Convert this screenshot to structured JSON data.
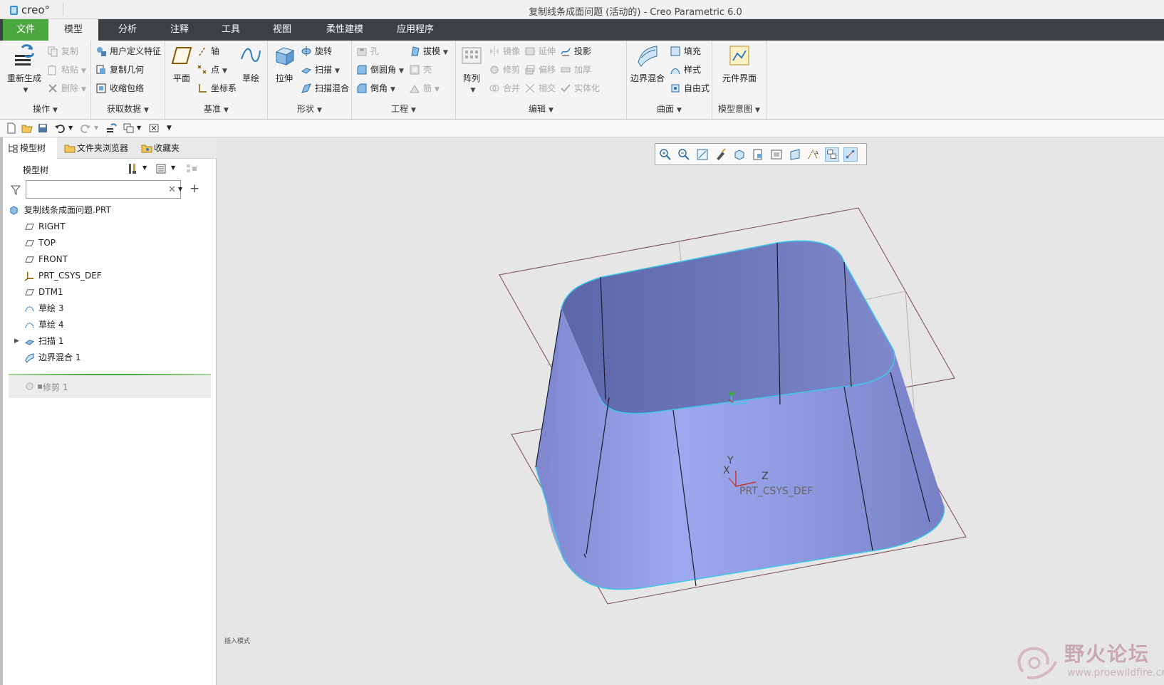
{
  "app": {
    "logo_text": "creo°",
    "window_title": "复制线条成面问题 (活动的) - Creo Parametric 6.0"
  },
  "menu": {
    "tabs": [
      "文件",
      "模型",
      "分析",
      "注释",
      "工具",
      "视图",
      "柔性建模",
      "应用程序"
    ],
    "active": "模型"
  },
  "ribbon": {
    "groups": {
      "operations": {
        "label": "操作",
        "regenerate": "重新生成",
        "copy": "复制",
        "paste": "粘贴",
        "delete": "删除"
      },
      "get_data": {
        "label": "获取数据",
        "udf": "用户定义特征",
        "copy_geom": "复制几何",
        "shrinkwrap": "收缩包络"
      },
      "datum": {
        "label": "基准",
        "plane": "平面",
        "axis": "轴",
        "point": "点",
        "csys": "坐标系",
        "sketch": "草绘"
      },
      "shapes": {
        "label": "形状",
        "extrude": "拉伸",
        "revolve": "旋转",
        "sweep": "扫描",
        "swept_blend": "扫描混合"
      },
      "engineering": {
        "label": "工程",
        "hole": "孔",
        "round": "倒圆角",
        "chamfer": "倒角",
        "draft": "拔模",
        "shell": "壳",
        "rib": "筋"
      },
      "editing": {
        "label": "编辑",
        "pattern": "阵列",
        "mirror": "镜像",
        "trim": "修剪",
        "merge": "合并",
        "extend": "延伸",
        "offset": "偏移",
        "intersect": "相交",
        "project": "投影",
        "thicken": "加厚",
        "solidify": "实体化"
      },
      "surfaces": {
        "label": "曲面",
        "boundary_blend": "边界混合",
        "fill": "填充",
        "style": "样式",
        "freestyle": "自由式"
      },
      "model_intent": {
        "label": "模型意图",
        "component_interface": "元件界面"
      }
    }
  },
  "navigator": {
    "tabs": [
      "模型树",
      "文件夹浏览器",
      "收藏夹"
    ],
    "tree_title": "模型树",
    "search_placeholder": "",
    "items": [
      {
        "label": "复制线条成面问题.PRT",
        "icon": "part-icon"
      },
      {
        "label": "RIGHT",
        "icon": "datum-plane-icon"
      },
      {
        "label": "TOP",
        "icon": "datum-plane-icon"
      },
      {
        "label": "FRONT",
        "icon": "datum-plane-icon"
      },
      {
        "label": "PRT_CSYS_DEF",
        "icon": "csys-icon"
      },
      {
        "label": "DTM1",
        "icon": "datum-plane-icon"
      },
      {
        "label": "草绘 3",
        "icon": "sketch-icon"
      },
      {
        "label": "草绘 4",
        "icon": "sketch-icon"
      },
      {
        "label": "扫描 1",
        "icon": "sweep-icon"
      },
      {
        "label": "边界混合 1",
        "icon": "boundary-blend-icon"
      }
    ],
    "suppressed_item": "修剪 1"
  },
  "viewport": {
    "csys_label": "PRT_CSYS_DEF",
    "axis_x": "X",
    "axis_y": "Y",
    "axis_z": "Z",
    "status_note": "插入模式",
    "surface_color": "#8d97dd",
    "datum_plane_color": "#7a4a52"
  },
  "watermark": {
    "text": "野火论坛",
    "url": "www.proewildfire.cn"
  }
}
